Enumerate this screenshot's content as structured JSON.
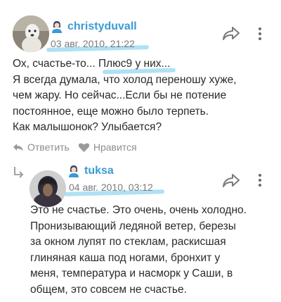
{
  "comments": [
    {
      "username": "christyduvall",
      "date": "03 авг. 2010, 21:22",
      "text": "Ох, счастье-то... Плюс9 у них...\nЯ всегда думала, что холод переношу хуже,\nчем жару. Но сейчас...Если бы не потение\nпостоянное, еще можно было терпеть.\nКак малышонок? Улыбается?",
      "actions": {
        "reply": "Ответить",
        "like": "Нравится"
      }
    },
    {
      "username": "tuksa",
      "date": "04 авг. 2010, 03:12",
      "text": "Это не счастье. Это очень, очень холодно.\nПронизывающий ледяной ветер, березы\nза окном лупят по стеклам, раскисшая\nглиняная каша под ногами, бронхит у\nменя, температура и насморк у Саши, в\nобщем, это совсем не счастье."
    }
  ],
  "colors": {
    "username": "#3a9bd5",
    "highlight": "#6ec8eb",
    "muted": "#8e8e8e"
  },
  "icons": [
    "user-icon",
    "share-icon",
    "more-icon",
    "reply-icon",
    "heart-icon",
    "reply-arrow-icon"
  ]
}
